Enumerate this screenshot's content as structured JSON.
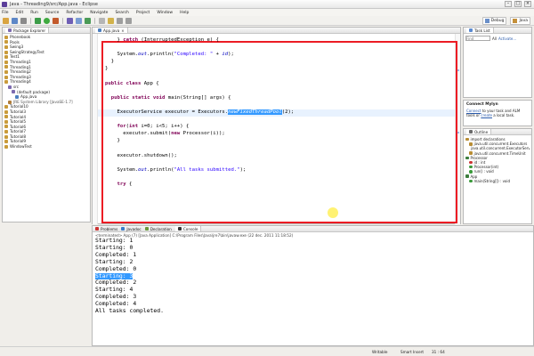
{
  "window": {
    "title": "Java - Threading9/src/App.java - Eclipse",
    "controls": [
      "–",
      "□",
      "×"
    ]
  },
  "menu": [
    "File",
    "Edit",
    "Run",
    "Source",
    "Refactor",
    "Navigate",
    "Search",
    "Project",
    "Window",
    "Help"
  ],
  "perspectives": [
    "Debug",
    "Java"
  ],
  "package_explorer": {
    "tab_label": "Package Explorer",
    "items": [
      {
        "label": "Phonebook",
        "indent": 0,
        "icon": "project"
      },
      {
        "label": "Pools",
        "indent": 0,
        "icon": "project"
      },
      {
        "label": "Swing3",
        "indent": 0,
        "icon": "project"
      },
      {
        "label": "SwingStrategyTest",
        "indent": 0,
        "icon": "project"
      },
      {
        "label": "Test1",
        "indent": 0,
        "icon": "project"
      },
      {
        "label": "Threading1",
        "indent": 0,
        "icon": "project"
      },
      {
        "label": "Threading1",
        "indent": 0,
        "icon": "project"
      },
      {
        "label": "Threading2",
        "indent": 0,
        "icon": "project"
      },
      {
        "label": "Threading3",
        "indent": 0,
        "icon": "project"
      },
      {
        "label": "Threading4",
        "indent": 0,
        "icon": "project"
      },
      {
        "label": "src",
        "indent": 1,
        "icon": "package"
      },
      {
        "label": "(default package)",
        "indent": 2,
        "icon": "package"
      },
      {
        "label": "App.java",
        "indent": 3,
        "icon": "java"
      },
      {
        "label": "JRE System Library [JavaSE-1.7]",
        "indent": 1,
        "icon": "library"
      },
      {
        "label": "Tutorial10",
        "indent": 0,
        "icon": "project"
      },
      {
        "label": "Tutorial3",
        "indent": 0,
        "icon": "project"
      },
      {
        "label": "Tutorial4",
        "indent": 0,
        "icon": "project"
      },
      {
        "label": "Tutorial5",
        "indent": 0,
        "icon": "project"
      },
      {
        "label": "Tutorial6",
        "indent": 0,
        "icon": "project"
      },
      {
        "label": "Tutorial7",
        "indent": 0,
        "icon": "project"
      },
      {
        "label": "Tutorial8",
        "indent": 0,
        "icon": "project"
      },
      {
        "label": "Tutorial9",
        "indent": 0,
        "icon": "project"
      },
      {
        "label": "WindowTest",
        "indent": 0,
        "icon": "project"
      }
    ]
  },
  "editor": {
    "tab_label": "App.java",
    "lines": [
      {
        "row": 0,
        "indent": 4,
        "tokens": [
          [
            "plain",
            "} "
          ],
          [
            "kw",
            "catch"
          ],
          [
            "plain",
            " (InterruptedException e) {"
          ]
        ]
      },
      {
        "row": 2,
        "indent": 4,
        "tokens": [
          [
            "plain",
            "System."
          ],
          [
            "fld",
            "out"
          ],
          [
            "plain",
            ".println("
          ],
          [
            "str",
            "\"Completed: \""
          ],
          [
            "plain",
            " + "
          ],
          [
            "fld",
            "id"
          ],
          [
            "plain",
            ");"
          ]
        ]
      },
      {
        "row": 3,
        "indent": 2,
        "tokens": [
          [
            "plain",
            "}"
          ]
        ]
      },
      {
        "row": 4,
        "indent": 0,
        "tokens": [
          [
            "plain",
            "}"
          ]
        ]
      },
      {
        "row": 6,
        "indent": 0,
        "tokens": [
          [
            "kw",
            "public class"
          ],
          [
            "plain",
            " App {"
          ]
        ]
      },
      {
        "row": 8,
        "indent": 2,
        "tokens": [
          [
            "kw",
            "public static void"
          ],
          [
            "plain",
            " main(String[] args) {"
          ]
        ]
      },
      {
        "row": 10,
        "indent": 4,
        "tokens": [
          [
            "plain",
            "ExecutorService executor = Executors."
          ],
          [
            "sel",
            "newFixedThreadPool"
          ],
          [
            "plain",
            "(2);"
          ]
        ]
      },
      {
        "row": 12,
        "indent": 4,
        "tokens": [
          [
            "kw",
            "for"
          ],
          [
            "plain",
            "("
          ],
          [
            "kw",
            "int"
          ],
          [
            "plain",
            " i=0; i<5; i++) {"
          ]
        ]
      },
      {
        "row": 13,
        "indent": 6,
        "tokens": [
          [
            "plain",
            "executor.submit("
          ],
          [
            "kw",
            "new"
          ],
          [
            "plain",
            " Processor(i));"
          ]
        ]
      },
      {
        "row": 14,
        "indent": 4,
        "tokens": [
          [
            "plain",
            "}"
          ]
        ]
      },
      {
        "row": 16,
        "indent": 4,
        "tokens": [
          [
            "plain",
            "executor.shutdown();"
          ]
        ]
      },
      {
        "row": 18,
        "indent": 4,
        "tokens": [
          [
            "plain",
            "System."
          ],
          [
            "fld",
            "out"
          ],
          [
            "plain",
            ".println("
          ],
          [
            "str",
            "\"All tasks submitted.\""
          ],
          [
            "plain",
            ");"
          ]
        ]
      },
      {
        "row": 20,
        "indent": 4,
        "tokens": [
          [
            "kw",
            "try"
          ],
          [
            "plain",
            " {"
          ]
        ]
      }
    ],
    "highlighted_row": 10
  },
  "bottom_panel": {
    "tabs": [
      "Problems",
      "Javadoc",
      "Declaration",
      "Console"
    ],
    "active_tab": "Console",
    "header": "<terminated> App (7) [Java Application] C:\\Program Files\\Java\\jre7\\bin\\javaw.exe (22 dec. 2011 11:18:52)",
    "output": [
      "Starting: 1",
      "Starting: 0",
      "Completed: 1",
      "Starting: 2",
      "Completed: 0",
      "Starting: 3",
      "Completed: 2",
      "Starting: 4",
      "Completed: 3",
      "Completed: 4",
      "All tasks completed."
    ],
    "selected_line_index": 5
  },
  "task_list": {
    "tab_label": "Task List",
    "find_placeholder": "Find",
    "all_label": "All",
    "activate_label": "Activate..."
  },
  "mylyn": {
    "title": "Connect Mylyn",
    "text_link1": "Connect",
    "text_mid": " to your task and ALM tools or ",
    "text_link2": "create",
    "text_end": " a local task."
  },
  "outline": {
    "tab_label": "Outline",
    "items": [
      {
        "label": "import declarations",
        "indent": 0,
        "icon": "import"
      },
      {
        "label": "java.util.concurrent.Executors",
        "indent": 1,
        "icon": "import"
      },
      {
        "label": "java.util.concurrent.ExecutorService",
        "indent": 1,
        "icon": "import"
      },
      {
        "label": "java.util.concurrent.TimeUnit",
        "indent": 1,
        "icon": "import"
      },
      {
        "label": "Processor",
        "indent": 0,
        "icon": "class"
      },
      {
        "label": "id : int",
        "indent": 1,
        "icon": "field"
      },
      {
        "label": "Processor(int)",
        "indent": 1,
        "icon": "method"
      },
      {
        "label": "run() : void",
        "indent": 1,
        "icon": "method"
      },
      {
        "label": "App",
        "indent": 0,
        "icon": "class"
      },
      {
        "label": "main(String[]) : void",
        "indent": 1,
        "icon": "method"
      }
    ]
  },
  "status": {
    "writable": "Writable",
    "insert_mode": "Smart Insert",
    "position": "31 : 64"
  }
}
